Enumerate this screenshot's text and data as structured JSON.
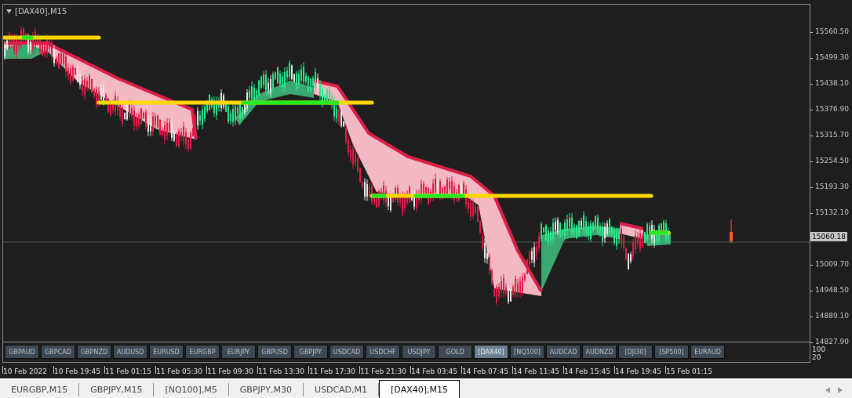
{
  "chart": {
    "title": "[DAX40],M15",
    "current_price": "15060.18"
  },
  "price_axis": [
    "15560.50",
    "15499.30",
    "15438.10",
    "15376.90",
    "15315.70",
    "15254.50",
    "15193.30",
    "15132.10",
    "15009.70",
    "14948.50",
    "14889.10",
    "14827.90"
  ],
  "symbol_buttons": [
    {
      "label": "GBPAUD",
      "selected": false
    },
    {
      "label": "GBPCAD",
      "selected": false
    },
    {
      "label": "GBPNZD",
      "selected": false
    },
    {
      "label": "AUDUSD",
      "selected": false
    },
    {
      "label": "EURUSD",
      "selected": false
    },
    {
      "label": "EURGBP",
      "selected": false
    },
    {
      "label": "EURJPY",
      "selected": false
    },
    {
      "label": "GBPUSD",
      "selected": false
    },
    {
      "label": "GBPJPY",
      "selected": false
    },
    {
      "label": "USDCAD",
      "selected": false
    },
    {
      "label": "USDCHF",
      "selected": false
    },
    {
      "label": "USDJPY",
      "selected": false
    },
    {
      "label": "GOLD",
      "selected": false
    },
    {
      "label": "[DAX40]",
      "selected": true
    },
    {
      "label": "[NQ100]",
      "selected": false
    },
    {
      "label": "AUDCAD",
      "selected": false
    },
    {
      "label": "AUDNZD",
      "selected": false
    },
    {
      "label": "[DJI30]",
      "selected": false
    },
    {
      "label": "[SP500]",
      "selected": false
    },
    {
      "label": "EURAUD",
      "selected": false
    }
  ],
  "indicator_scale": [
    "100",
    "20"
  ],
  "time_axis": [
    "10 Feb 2022",
    "10 Feb 19:45",
    "11 Feb 01:15",
    "11 Feb 05:30",
    "11 Feb 09:30",
    "11 Feb 13:30",
    "11 Feb 17:30",
    "11 Feb 21:30",
    "14 Feb 03:45",
    "14 Feb 07:45",
    "14 Feb 11:45",
    "14 Feb 15:45",
    "14 Feb 19:45",
    "15 Feb 01:15"
  ],
  "tabs": [
    {
      "label": "EURGBP,M15",
      "selected": false
    },
    {
      "label": "GBPJPY,M15",
      "selected": false
    },
    {
      "label": "[NQ100],M5",
      "selected": false
    },
    {
      "label": "GBPJPY,M30",
      "selected": false
    },
    {
      "label": "USDCAD,M1",
      "selected": false
    },
    {
      "label": "[DAX40],M15",
      "selected": true
    }
  ]
}
